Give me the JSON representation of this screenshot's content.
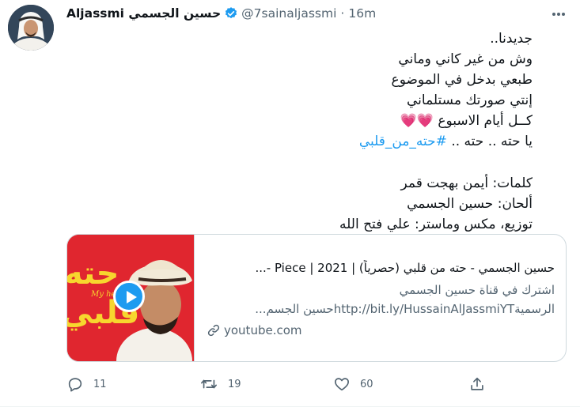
{
  "author": {
    "display_name": "Aljassmi حسين الجسمي",
    "handle": "@7sainaljassmi",
    "time": "16m",
    "separator": "·"
  },
  "tweet": {
    "lines": [
      "جديدنا..",
      "وش من غير كاني وماني",
      "طبعي بدخل في الموضوع",
      "إنتي صورتك مستلماني",
      "كــل أيام الاسبوع 💗💗"
    ],
    "hashtag_prefix": "يا حته .. حته .. ",
    "hashtag": "#حته_من_قلبي",
    "credits": [
      "كلمات: أيمن بهجت قمر",
      "ألحان: حسين الجسمي",
      "توزيع، مكس وماستر: علي فتح الله"
    ]
  },
  "card": {
    "title": "حسين الجسمي - حته من قلبي (حصرياً) | 2021 | Piece -...",
    "desc_line1": "اشترك في قناة حسين الجسمي",
    "desc_line2": "الرسميةhttp://bit.ly/HussainAlJassmiYTحسين الجسم...",
    "domain": "youtube.com",
    "thumbnail_text": "حته من قلبي",
    "thumbnail_script": "My heart"
  },
  "actions": {
    "replies": "11",
    "retweets": "19",
    "likes": "60"
  },
  "colors": {
    "link": "#1d9bf0",
    "muted": "#536471",
    "thumbnail_bg": "#e0262f"
  }
}
